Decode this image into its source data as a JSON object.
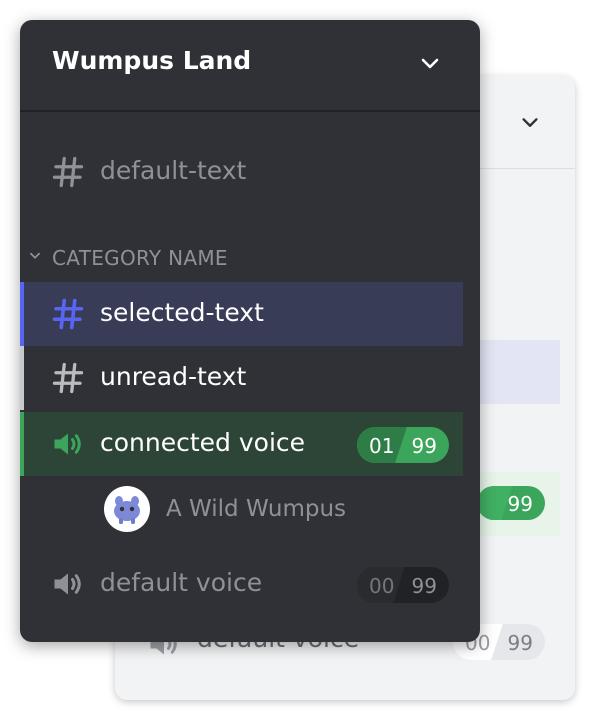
{
  "server": {
    "name": "Wumpus Land"
  },
  "channels": {
    "default_text": {
      "name": "default-text",
      "icon": "hash-icon"
    },
    "category": {
      "name": "CATEGORY NAME"
    },
    "selected_text": {
      "name": "selected-text",
      "icon": "hash-icon"
    },
    "unread_text": {
      "name": "unread-text",
      "icon": "hash-icon"
    },
    "connected_voice": {
      "name": "connected voice",
      "icon": "speaker-icon",
      "count": "01",
      "limit": "99"
    },
    "voice_user": {
      "name": "A Wild Wumpus",
      "icon": "wumpus-avatar"
    },
    "default_voice": {
      "name": "default voice",
      "icon": "speaker-icon",
      "count": "00",
      "limit": "99"
    }
  },
  "light_preview": {
    "connected_limit": "99",
    "default_voice": {
      "name": "default voice",
      "count": "00",
      "limit": "99"
    }
  },
  "colors": {
    "dark_bg": "#2f3136",
    "selected_accent": "#5865f2",
    "connected_accent": "#3ba55c",
    "unread_indicator": "#c7c9cb"
  }
}
